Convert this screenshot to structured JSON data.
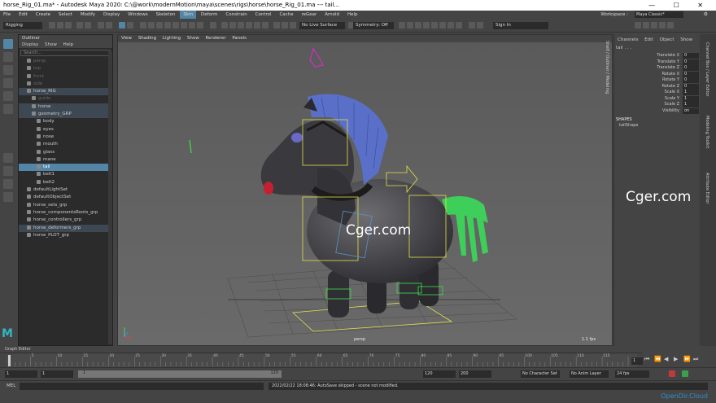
{
  "title": "horse_Rig_01.ma* - Autodesk Maya 2020: C:\\@work\\modernMotion\\maya\\scenes\\rigs\\horse\\horse_Rig_01.ma   ---   tail...",
  "window_controls": [
    "—",
    "☐",
    "✕"
  ],
  "menu": [
    "File",
    "Edit",
    "Create",
    "Select",
    "Modify",
    "Display",
    "Windows",
    "Skeleton",
    "Skin",
    "Deform",
    "Constrain",
    "Control",
    "Cache",
    "reGear",
    "Arnold",
    "Help"
  ],
  "workspace": {
    "label": "Workspace :",
    "value": "Maya Classic*"
  },
  "statusline": {
    "mode": "Rigging",
    "live_surface": "No Live Surface",
    "symmetry": "Symmetry: Off",
    "sign_in": "Sign In"
  },
  "outliner": {
    "title": "Outliner",
    "menu": [
      "Display",
      "Show",
      "Help"
    ],
    "search_placeholder": "Search...",
    "items": [
      {
        "label": "persp",
        "indent": 1,
        "state": "dim"
      },
      {
        "label": "top",
        "indent": 1,
        "state": "dim"
      },
      {
        "label": "front",
        "indent": 1,
        "state": "dim"
      },
      {
        "label": "side",
        "indent": 1,
        "state": "dim"
      },
      {
        "label": "horse_RIG",
        "indent": 1,
        "state": "grp"
      },
      {
        "label": "guide",
        "indent": 2,
        "state": "dim"
      },
      {
        "label": "horse",
        "indent": 2,
        "state": "grp"
      },
      {
        "label": "geometry_GRP",
        "indent": 2,
        "state": "grp"
      },
      {
        "label": "body",
        "indent": 3,
        "state": ""
      },
      {
        "label": "eyes",
        "indent": 3,
        "state": ""
      },
      {
        "label": "nose",
        "indent": 3,
        "state": ""
      },
      {
        "label": "mouth",
        "indent": 3,
        "state": ""
      },
      {
        "label": "glass",
        "indent": 3,
        "state": ""
      },
      {
        "label": "mane",
        "indent": 3,
        "state": ""
      },
      {
        "label": "tail",
        "indent": 3,
        "state": "sel"
      },
      {
        "label": "belt1",
        "indent": 3,
        "state": ""
      },
      {
        "label": "belt2",
        "indent": 3,
        "state": ""
      },
      {
        "label": "defaultLightSet",
        "indent": 1,
        "state": ""
      },
      {
        "label": "defaultObjectSet",
        "indent": 1,
        "state": ""
      },
      {
        "label": "horse_sets_grp",
        "indent": 1,
        "state": ""
      },
      {
        "label": "horse_componentsRoots_grp",
        "indent": 1,
        "state": ""
      },
      {
        "label": "horse_controllers_grp",
        "indent": 1,
        "state": ""
      },
      {
        "label": "horse_deformers_grp",
        "indent": 1,
        "state": "grp"
      },
      {
        "label": "horse_PLOT_grp",
        "indent": 1,
        "state": ""
      }
    ]
  },
  "viewport": {
    "menu": [
      "View",
      "Shading",
      "Lighting",
      "Show",
      "Renderer",
      "Panels"
    ],
    "camera": "persp",
    "fps": "1.1 fps",
    "watermark": "Cger.com"
  },
  "channelbox": {
    "menu": [
      "Channels",
      "Edit",
      "Object",
      "Show"
    ],
    "object": "tail . . .",
    "attrs": [
      {
        "name": "Translate X",
        "value": "0"
      },
      {
        "name": "Translate Y",
        "value": "0"
      },
      {
        "name": "Translate Z",
        "value": "0"
      },
      {
        "name": "Rotate X",
        "value": "0"
      },
      {
        "name": "Rotate Y",
        "value": "0"
      },
      {
        "name": "Rotate Z",
        "value": "0"
      },
      {
        "name": "Scale X",
        "value": "1"
      },
      {
        "name": "Scale Y",
        "value": "1"
      },
      {
        "name": "Scale Z",
        "value": "1"
      },
      {
        "name": "Visibility",
        "value": "on"
      }
    ],
    "shapes_label": "SHAPES",
    "shape_name": "tailShape",
    "watermark": "Cger.com"
  },
  "side_tabs": [
    "Channel Box / Layer Editor",
    "Modeling Toolkit",
    "Attribute Editor"
  ],
  "left_vertical_tab": "Shelf / Outliner / Modeling",
  "graph_editor": "Graph Editor",
  "timeline": {
    "ticks": [
      "5",
      "10",
      "15",
      "20",
      "25",
      "30",
      "35",
      "40",
      "45",
      "50",
      "55",
      "60",
      "65",
      "70",
      "75",
      "80",
      "85",
      "90",
      "95",
      "100",
      "105",
      "110",
      "115"
    ],
    "current_frame": "1"
  },
  "range": {
    "start": "1",
    "inner_start": "1",
    "anim_start": "1",
    "anim_end": "120",
    "end": "120",
    "total_end": "200",
    "char_set": "No Character Set",
    "anim_layer": "No Anim Layer",
    "fps": "24 fps"
  },
  "cmdline": {
    "label": "MEL"
  },
  "helpline": {
    "message": "2022/02/22 18:08:46: AutoSave skipped - scene not modified."
  },
  "footer_watermark": "OpenDir.Cloud"
}
